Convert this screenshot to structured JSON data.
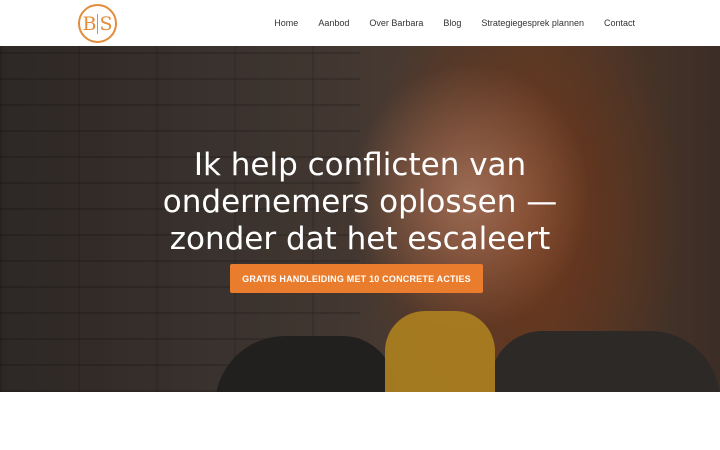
{
  "brand": {
    "logo_text_left": "B",
    "logo_text_right": "S",
    "accent_color": "#e38c3a"
  },
  "nav": {
    "items": [
      {
        "label": "Home"
      },
      {
        "label": "Aanbod"
      },
      {
        "label": "Over Barbara"
      },
      {
        "label": "Blog"
      },
      {
        "label": "Strategiegesprek plannen"
      },
      {
        "label": "Contact"
      }
    ]
  },
  "hero": {
    "title_line1": "Ik help conflicten van",
    "title_line2": "ondernemers oplossen —",
    "title_line3": "zonder dat het escaleert",
    "cta_label": "GRATIS HANDLEIDING MET 10 CONCRETE ACTIES",
    "cta_color": "#ea7d2d"
  }
}
